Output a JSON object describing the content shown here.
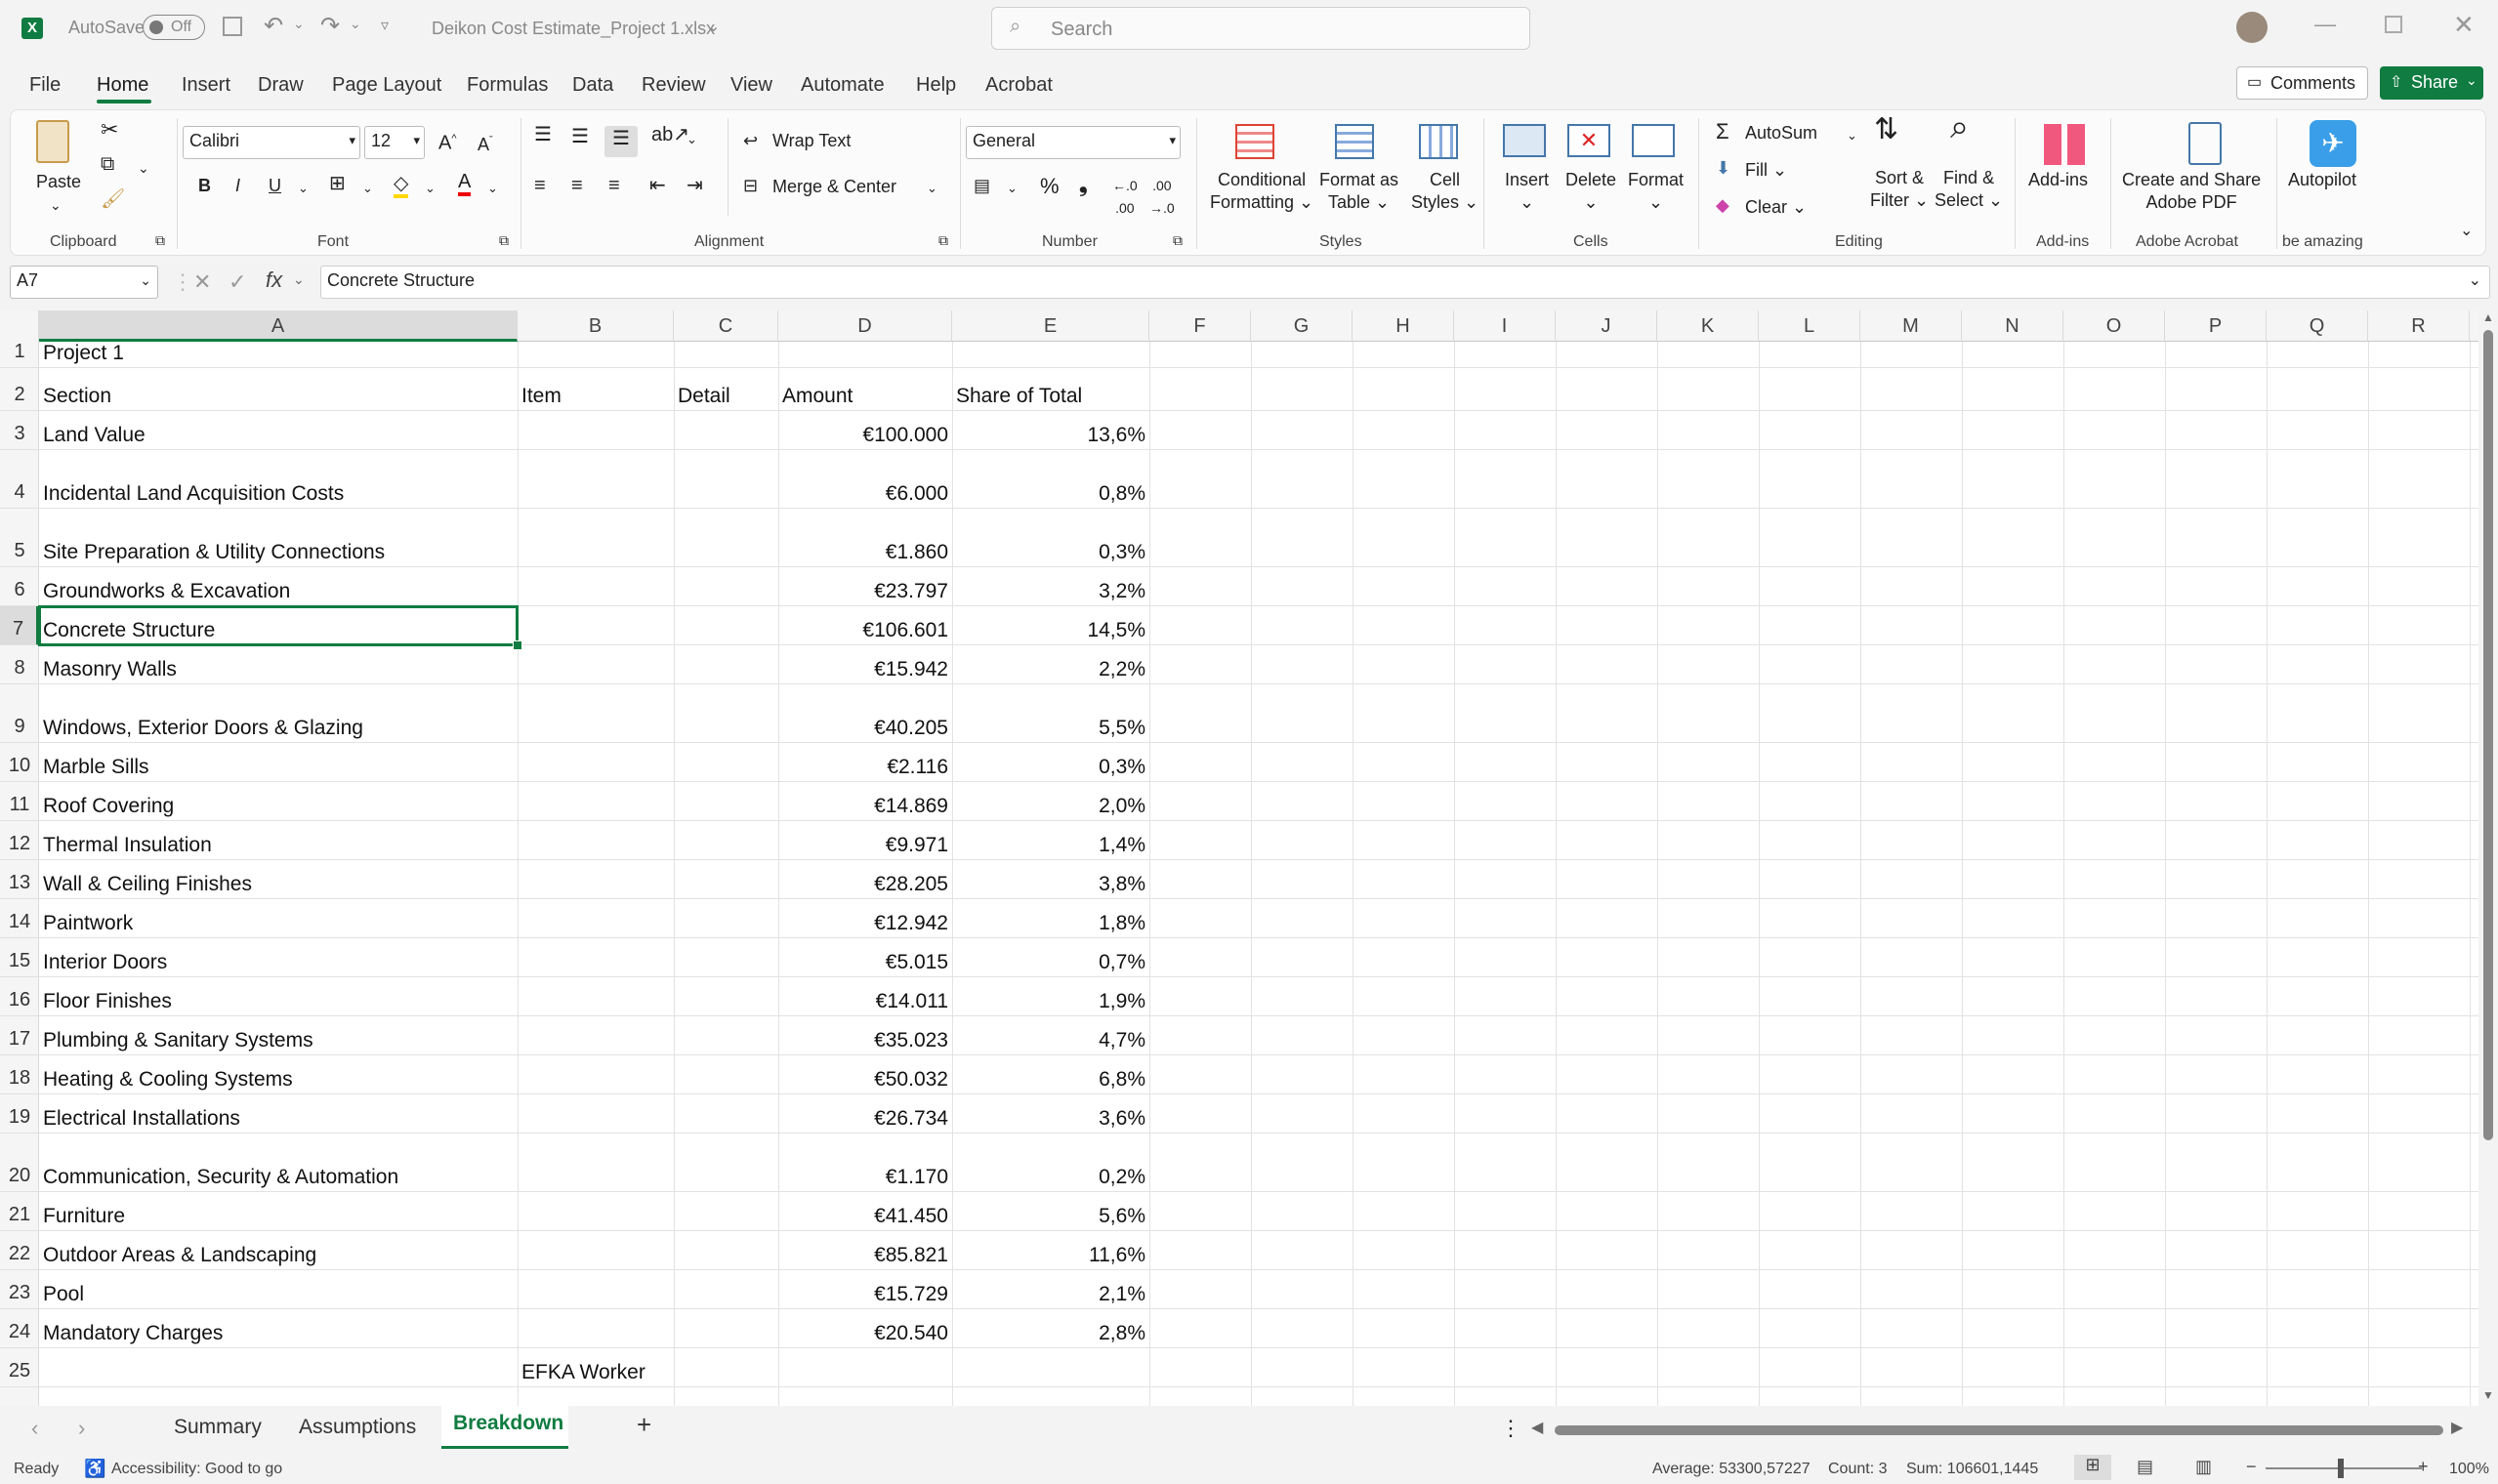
{
  "titlebar": {
    "autosave_label": "AutoSave",
    "autosave_state": "Off",
    "filename": "Deikon Cost Estimate_Project 1.xlsx",
    "search_placeholder": "Search"
  },
  "menu": {
    "items": [
      "File",
      "Home",
      "Insert",
      "Draw",
      "Page Layout",
      "Formulas",
      "Data",
      "Review",
      "View",
      "Automate",
      "Help",
      "Acrobat"
    ],
    "active": "Home",
    "comments_label": "Comments",
    "share_label": "Share"
  },
  "ribbon": {
    "clipboard": {
      "paste": "Paste",
      "label": "Clipboard"
    },
    "font": {
      "name": "Calibri",
      "size": "12",
      "label": "Font"
    },
    "alignment": {
      "wrap_text": "Wrap Text",
      "merge_center": "Merge & Center",
      "label": "Alignment"
    },
    "number": {
      "format": "General",
      "label": "Number"
    },
    "styles": {
      "conditional": "Conditional",
      "conditional2": "Formatting",
      "format_table": "Format as",
      "format_table2": "Table",
      "cell_styles": "Cell",
      "cell_styles2": "Styles",
      "label": "Styles"
    },
    "cells": {
      "insert": "Insert",
      "delete": "Delete",
      "format": "Format",
      "label": "Cells"
    },
    "editing": {
      "autosum": "AutoSum",
      "fill": "Fill",
      "clear": "Clear",
      "sort": "Sort &",
      "sort2": "Filter",
      "find": "Find &",
      "find2": "Select",
      "label": "Editing"
    },
    "addins": {
      "button": "Add-ins",
      "label": "Add-ins"
    },
    "acrobat": {
      "button": "Create and Share",
      "button2": "Adobe PDF",
      "label": "Adobe Acrobat"
    },
    "autopilot": {
      "button": "Autopilot",
      "label": "be amazing"
    }
  },
  "formula_bar": {
    "name_box": "A7",
    "fx": "fx",
    "content": "Concrete Structure"
  },
  "columns": [
    "A",
    "B",
    "C",
    "D",
    "E",
    "F",
    "G",
    "H",
    "I",
    "J",
    "K",
    "L",
    "M",
    "N",
    "O",
    "P",
    "Q",
    "R"
  ],
  "sheet": {
    "title": "Project 1",
    "headers": {
      "section": "Section",
      "item": "Item",
      "detail": "Detail",
      "amount": "Amount",
      "share": "Share of Total"
    },
    "rows": [
      {
        "n": "3",
        "section": "Land Value",
        "amount": "€100.000",
        "share": "13,6%"
      },
      {
        "n": "4",
        "section": "Incidental Land Acquisition Costs",
        "amount": "€6.000",
        "share": "0,8%"
      },
      {
        "n": "5",
        "section": "Site Preparation & Utility Connections",
        "amount": "€1.860",
        "share": "0,3%"
      },
      {
        "n": "6",
        "section": "Groundworks & Excavation",
        "amount": "€23.797",
        "share": "3,2%"
      },
      {
        "n": "7",
        "section": "Concrete Structure",
        "amount": "€106.601",
        "share": "14,5%"
      },
      {
        "n": "8",
        "section": "Masonry Walls",
        "amount": "€15.942",
        "share": "2,2%"
      },
      {
        "n": "9",
        "section": "Windows, Exterior Doors & Glazing",
        "amount": "€40.205",
        "share": "5,5%"
      },
      {
        "n": "10",
        "section": "Marble Sills",
        "amount": "€2.116",
        "share": "0,3%"
      },
      {
        "n": "11",
        "section": "Roof Covering",
        "amount": "€14.869",
        "share": "2,0%"
      },
      {
        "n": "12",
        "section": "Thermal Insulation",
        "amount": "€9.971",
        "share": "1,4%"
      },
      {
        "n": "13",
        "section": "Wall & Ceiling Finishes",
        "amount": "€28.205",
        "share": "3,8%"
      },
      {
        "n": "14",
        "section": "Paintwork",
        "amount": "€12.942",
        "share": "1,8%"
      },
      {
        "n": "15",
        "section": "Interior Doors",
        "amount": "€5.015",
        "share": "0,7%"
      },
      {
        "n": "16",
        "section": "Floor Finishes",
        "amount": "€14.011",
        "share": "1,9%"
      },
      {
        "n": "17",
        "section": "Plumbing & Sanitary Systems",
        "amount": "€35.023",
        "share": "4,7%"
      },
      {
        "n": "18",
        "section": "Heating & Cooling Systems",
        "amount": "€50.032",
        "share": "6,8%"
      },
      {
        "n": "19",
        "section": "Electrical Installations",
        "amount": "€26.734",
        "share": "3,6%"
      },
      {
        "n": "20",
        "section": "Communication, Security & Automation",
        "amount": "€1.170",
        "share": "0,2%"
      },
      {
        "n": "21",
        "section": "Furniture",
        "amount": "€41.450",
        "share": "5,6%"
      },
      {
        "n": "22",
        "section": "Outdoor Areas & Landscaping",
        "amount": "€85.821",
        "share": "11,6%"
      },
      {
        "n": "23",
        "section": "Pool",
        "amount": "€15.729",
        "share": "2,1%"
      },
      {
        "n": "24",
        "section": "Mandatory Charges",
        "amount": "€20.540",
        "share": "2,8%"
      }
    ],
    "partial_row_item": "EFKA Worker"
  },
  "tabs": {
    "items": [
      "Summary",
      "Assumptions",
      "Breakdown"
    ],
    "active": "Breakdown",
    "add": "+"
  },
  "status": {
    "ready": "Ready",
    "accessibility": "Accessibility: Good to go",
    "average": "Average: 53300,57227",
    "count": "Count: 3",
    "sum": "Sum: 106601,1445",
    "zoom": "100%"
  },
  "colors": {
    "accent": "#107c41",
    "selected_cell_border": "#107c41"
  }
}
